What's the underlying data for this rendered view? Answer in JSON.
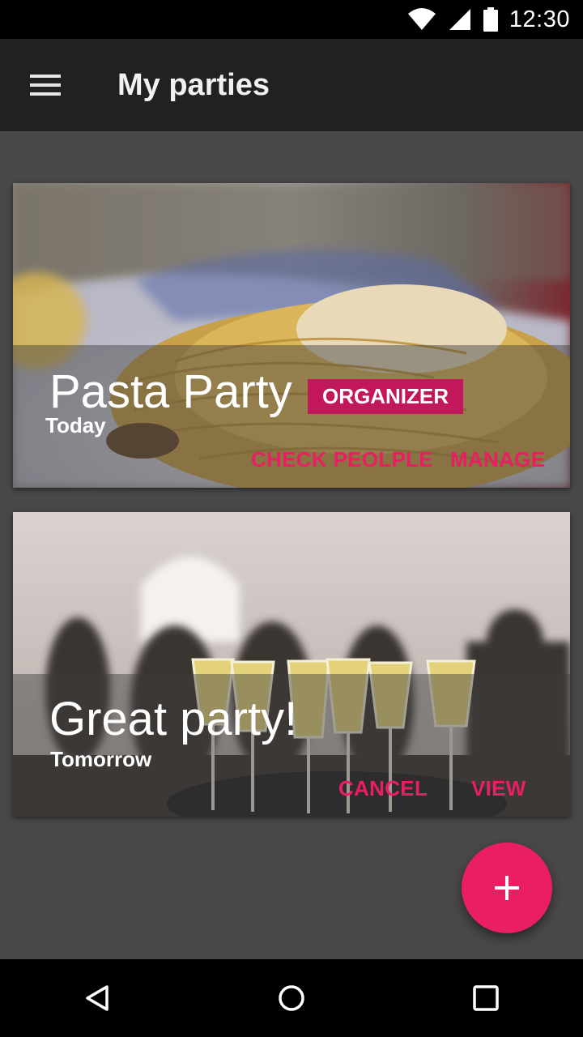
{
  "status_bar": {
    "time": "12:30",
    "icons": [
      "wifi-icon",
      "signal-icon",
      "battery-icon"
    ]
  },
  "app_bar": {
    "title": "My parties",
    "menu_icon": "hamburger-menu-icon"
  },
  "cards": [
    {
      "title": "Pasta Party",
      "date": "Today",
      "badge": "ORGANIZER",
      "actions": [
        "CHECK PEOLPLE",
        "MANAGE"
      ],
      "image": "pasta-photo"
    },
    {
      "title": "Great party!",
      "date": "Tomorrow",
      "actions": [
        "CANCEL",
        "VIEW"
      ],
      "image": "champagne-party-photo"
    }
  ],
  "fab": {
    "icon": "plus-icon"
  },
  "nav_bar": {
    "icons": [
      "back-icon",
      "home-icon",
      "recents-icon"
    ]
  },
  "colors": {
    "accent": "#e91e63",
    "badge": "#c2185b",
    "app_bar": "#212121",
    "background": "#484848"
  }
}
